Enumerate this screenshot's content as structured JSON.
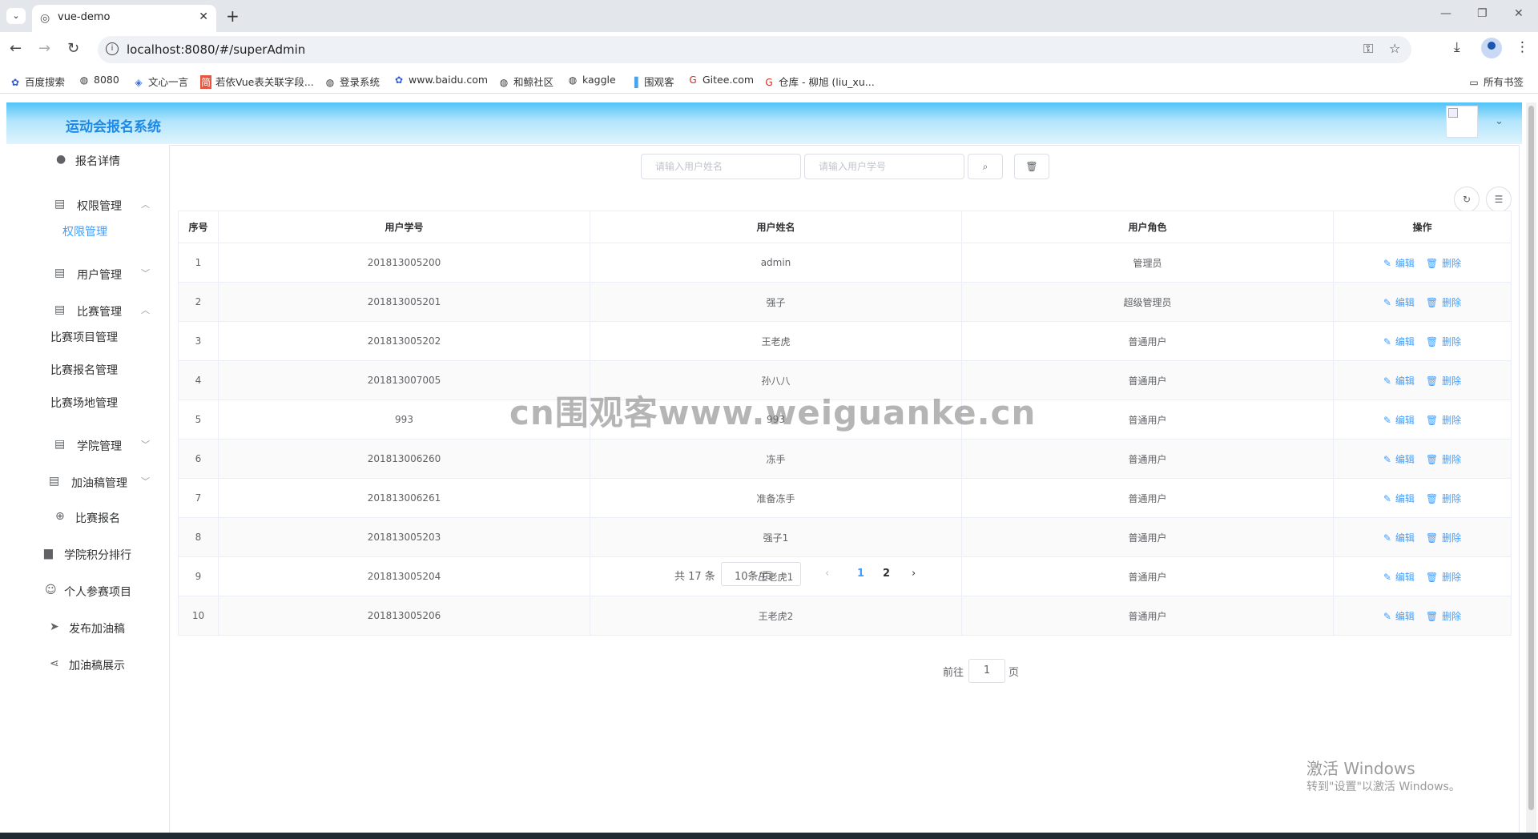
{
  "browser": {
    "tab_title": "vue-demo",
    "url": "localhost:8080/#/superAdmin",
    "bookmarks": [
      "百度搜索",
      "8080",
      "文心一言",
      "若依Vue表关联字段...",
      "登录系统",
      "www.baidu.com",
      "和鲸社区",
      "kaggle",
      "围观客",
      "Gitee.com",
      "仓库 - 柳旭 (liu_xu..."
    ],
    "all_bookmarks": "所有书签"
  },
  "app": {
    "title": "运动会报名系统"
  },
  "sidebar": {
    "items": [
      {
        "label": "报名详情",
        "icon": "bulb-icon"
      },
      {
        "label": "权限管理",
        "icon": "clipboard-icon"
      },
      {
        "label": "权限管理"
      },
      {
        "label": "用户管理",
        "icon": "clipboard-icon"
      },
      {
        "label": "比赛管理",
        "icon": "clipboard-icon"
      },
      {
        "label": "比赛项目管理"
      },
      {
        "label": "比赛报名管理"
      },
      {
        "label": "比赛场地管理"
      },
      {
        "label": "学院管理",
        "icon": "clipboard-icon"
      },
      {
        "label": "加油稿管理",
        "icon": "clipboard-icon"
      },
      {
        "label": "比赛报名",
        "icon": "plus-circle-icon"
      },
      {
        "label": "学院积分排行",
        "icon": "bar-chart-icon"
      },
      {
        "label": "个人参赛项目",
        "icon": "user-icon"
      },
      {
        "label": "发布加油稿",
        "icon": "send-icon"
      },
      {
        "label": "加油稿展示",
        "icon": "share-icon"
      }
    ]
  },
  "search": {
    "name_placeholder": "请输入用户姓名",
    "id_placeholder": "请输入用户学号"
  },
  "table": {
    "headers": [
      "序号",
      "用户学号",
      "用户姓名",
      "用户角色",
      "操作"
    ],
    "rows": [
      {
        "no": "1",
        "id": "201813005200",
        "name": "admin",
        "role": "管理员"
      },
      {
        "no": "2",
        "id": "201813005201",
        "name": "强子",
        "role": "超级管理员"
      },
      {
        "no": "3",
        "id": "201813005202",
        "name": "王老虎",
        "role": "普通用户"
      },
      {
        "no": "4",
        "id": "201813007005",
        "name": "孙八八",
        "role": "普通用户"
      },
      {
        "no": "5",
        "id": "993",
        "name": "993",
        "role": "普通用户"
      },
      {
        "no": "6",
        "id": "201813006260",
        "name": "冻手",
        "role": "普通用户"
      },
      {
        "no": "7",
        "id": "201813006261",
        "name": "准备冻手",
        "role": "普通用户"
      },
      {
        "no": "8",
        "id": "201813005203",
        "name": "强子1",
        "role": "普通用户"
      },
      {
        "no": "9",
        "id": "201813005204",
        "name": "王老虎1",
        "role": "普通用户"
      },
      {
        "no": "10",
        "id": "201813005206",
        "name": "王老虎2",
        "role": "普通用户"
      }
    ],
    "edit_label": "编辑",
    "delete_label": "删除"
  },
  "pagination": {
    "total": "共 17 条",
    "page_size": "10条/页",
    "pages": [
      "1",
      "2"
    ],
    "current_page": "1",
    "goto_prefix": "前往",
    "goto_value": "1",
    "goto_suffix": "页"
  },
  "overlay": {
    "watermark": "cn围观客www.weiguanke.cn",
    "activate_title": "激活 Windows",
    "activate_sub": "转到\"设置\"以激活 Windows。"
  },
  "colors": {
    "accent": "#409eff",
    "title": "#1e88e5",
    "header_gradient_top": "#4fc3f7"
  }
}
